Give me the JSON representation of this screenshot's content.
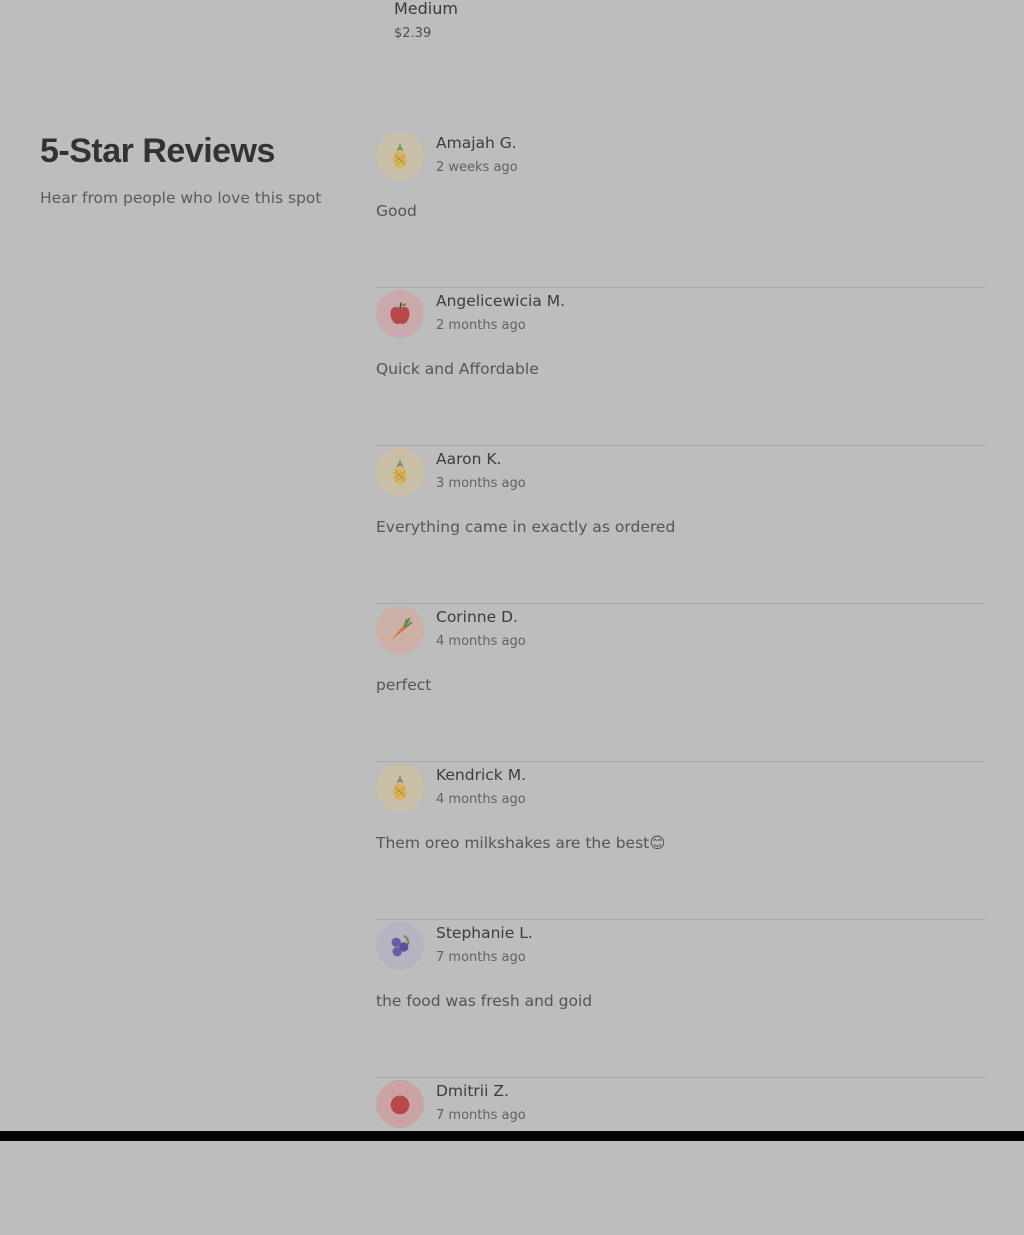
{
  "top_item": {
    "name": "Medium",
    "price": "$2.39"
  },
  "section": {
    "title": "5-Star Reviews",
    "subtitle": "Hear from people who love this spot"
  },
  "reviews": [
    {
      "name": "Amajah G.",
      "time": "2 weeks ago",
      "text": "Good",
      "avatar_icon": "pineapple-icon",
      "avatar_bg": "#c9bfa7"
    },
    {
      "name": "Angelicewicia M.",
      "time": "2 months ago",
      "text": "Quick and Affordable",
      "avatar_icon": "apple-icon",
      "avatar_bg": "#c9aaaa"
    },
    {
      "name": "Aaron K.",
      "time": "3 months ago",
      "text": "Everything came in exactly as ordered",
      "avatar_icon": "pineapple-icon",
      "avatar_bg": "#c9bfa7"
    },
    {
      "name": "Corinne D.",
      "time": "4 months ago",
      "text": "perfect",
      "avatar_icon": "carrot-icon",
      "avatar_bg": "#cdb0a6"
    },
    {
      "name": "Kendrick M.",
      "time": "4 months ago",
      "text": "Them oreo milkshakes are the best😊",
      "avatar_icon": "pineapple-icon",
      "avatar_bg": "#c9bfa7"
    },
    {
      "name": "Stephanie L.",
      "time": "7 months ago",
      "text": "the food was fresh and goid",
      "avatar_icon": "blueberries-icon",
      "avatar_bg": "#b7b4c2"
    },
    {
      "name": "Dmitrii Z.",
      "time": "7 months ago",
      "text": "",
      "avatar_icon": "tomato-icon",
      "avatar_bg": "#cba3a3"
    }
  ]
}
